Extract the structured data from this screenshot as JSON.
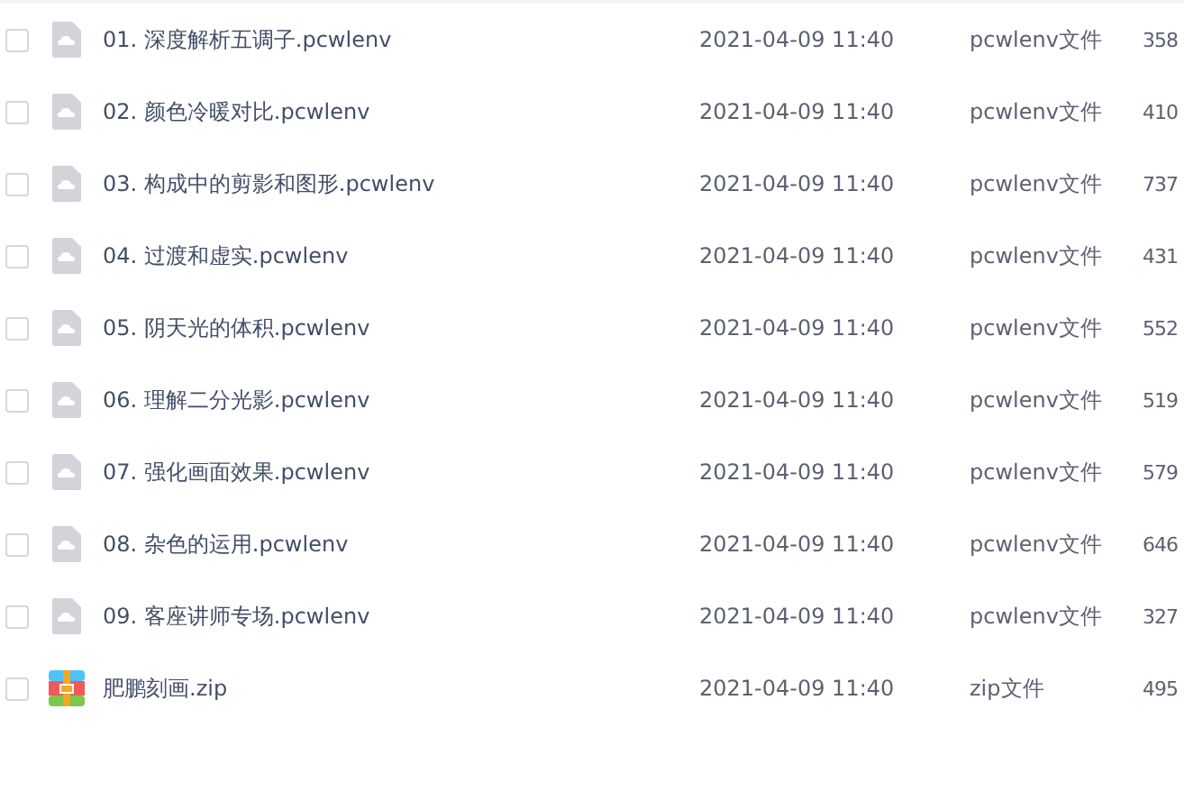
{
  "files": [
    {
      "kind": "pcwlenv",
      "name": "01. 深度解析五调子.pcwlenv",
      "modified": "2021-04-09 11:40",
      "type": "pcwlenv文件",
      "size": "358",
      "checked": false
    },
    {
      "kind": "pcwlenv",
      "name": "02. 颜色冷暖对比.pcwlenv",
      "modified": "2021-04-09 11:40",
      "type": "pcwlenv文件",
      "size": "410",
      "checked": false
    },
    {
      "kind": "pcwlenv",
      "name": "03. 构成中的剪影和图形.pcwlenv",
      "modified": "2021-04-09 11:40",
      "type": "pcwlenv文件",
      "size": "737",
      "checked": false
    },
    {
      "kind": "pcwlenv",
      "name": "04. 过渡和虚实.pcwlenv",
      "modified": "2021-04-09 11:40",
      "type": "pcwlenv文件",
      "size": "431",
      "checked": false
    },
    {
      "kind": "pcwlenv",
      "name": "05. 阴天光的体积.pcwlenv",
      "modified": "2021-04-09 11:40",
      "type": "pcwlenv文件",
      "size": "552",
      "checked": false
    },
    {
      "kind": "pcwlenv",
      "name": "06. 理解二分光影.pcwlenv",
      "modified": "2021-04-09 11:40",
      "type": "pcwlenv文件",
      "size": "519",
      "checked": false
    },
    {
      "kind": "pcwlenv",
      "name": "07. 强化画面效果.pcwlenv",
      "modified": "2021-04-09 11:40",
      "type": "pcwlenv文件",
      "size": "579",
      "checked": false
    },
    {
      "kind": "pcwlenv",
      "name": "08. 杂色的运用.pcwlenv",
      "modified": "2021-04-09 11:40",
      "type": "pcwlenv文件",
      "size": "646",
      "checked": false
    },
    {
      "kind": "pcwlenv",
      "name": "09. 客座讲师专场.pcwlenv",
      "modified": "2021-04-09 11:40",
      "type": "pcwlenv文件",
      "size": "327",
      "checked": false
    },
    {
      "kind": "zip",
      "name": "肥鹏刻画.zip",
      "modified": "2021-04-09 11:40",
      "type": "zip文件",
      "size": "495",
      "checked": false
    }
  ]
}
